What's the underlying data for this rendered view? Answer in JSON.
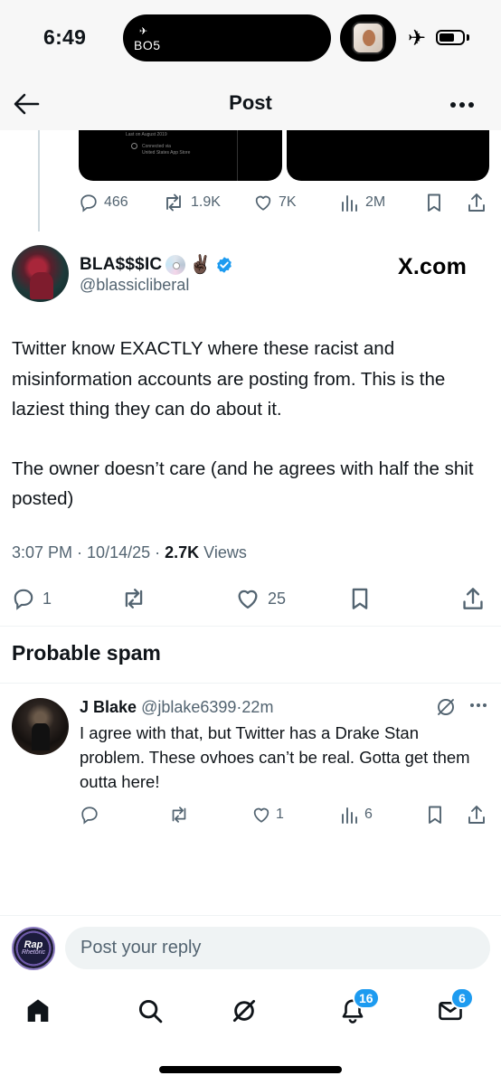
{
  "status_bar": {
    "time": "6:49",
    "live_activity_flight": "BO5",
    "airplane_mode": true
  },
  "nav": {
    "title": "Post"
  },
  "previous_post": {
    "media_text": {
      "line1": "Last on August 2019",
      "line2": "Connected via",
      "line3": "United States App Store"
    },
    "replies": "466",
    "reposts": "1.9K",
    "likes": "7K",
    "views": "2M"
  },
  "main_post": {
    "author_name": "BLA$$$IC",
    "author_emoji": "✌🏿",
    "author_handle": "@blassicliberal",
    "watermark": "X.com",
    "text_p1": "Twitter know EXACTLY where these racist and misinformation accounts are posting from. This is the laziest thing they can do about it.",
    "text_p2": "The owner doesn’t care (and he agrees with half the shit posted)",
    "time": "3:07 PM",
    "date": "10/14/25",
    "views_count": "2.7K",
    "views_label": "Views",
    "replies": "1",
    "likes": "25"
  },
  "probable_spam": {
    "heading": "Probable spam"
  },
  "reply": {
    "author_name": "J Blake",
    "author_handle": "@jblake6399",
    "time_ago": "22m",
    "text": "I agree with that, but Twitter has a Drake Stan problem. These ovhoes can’t be real. Gotta get them outta here!",
    "likes": "1",
    "views": "6"
  },
  "compose": {
    "avatar_text_1": "Rap",
    "avatar_text_2": "Rhetoric",
    "placeholder": "Post your reply"
  },
  "tabbar": {
    "notifications_badge": "16",
    "messages_badge": "6"
  },
  "colors": {
    "accent": "#1d9bf0",
    "secondary_text": "#536471",
    "primary_text": "#0f1419"
  }
}
